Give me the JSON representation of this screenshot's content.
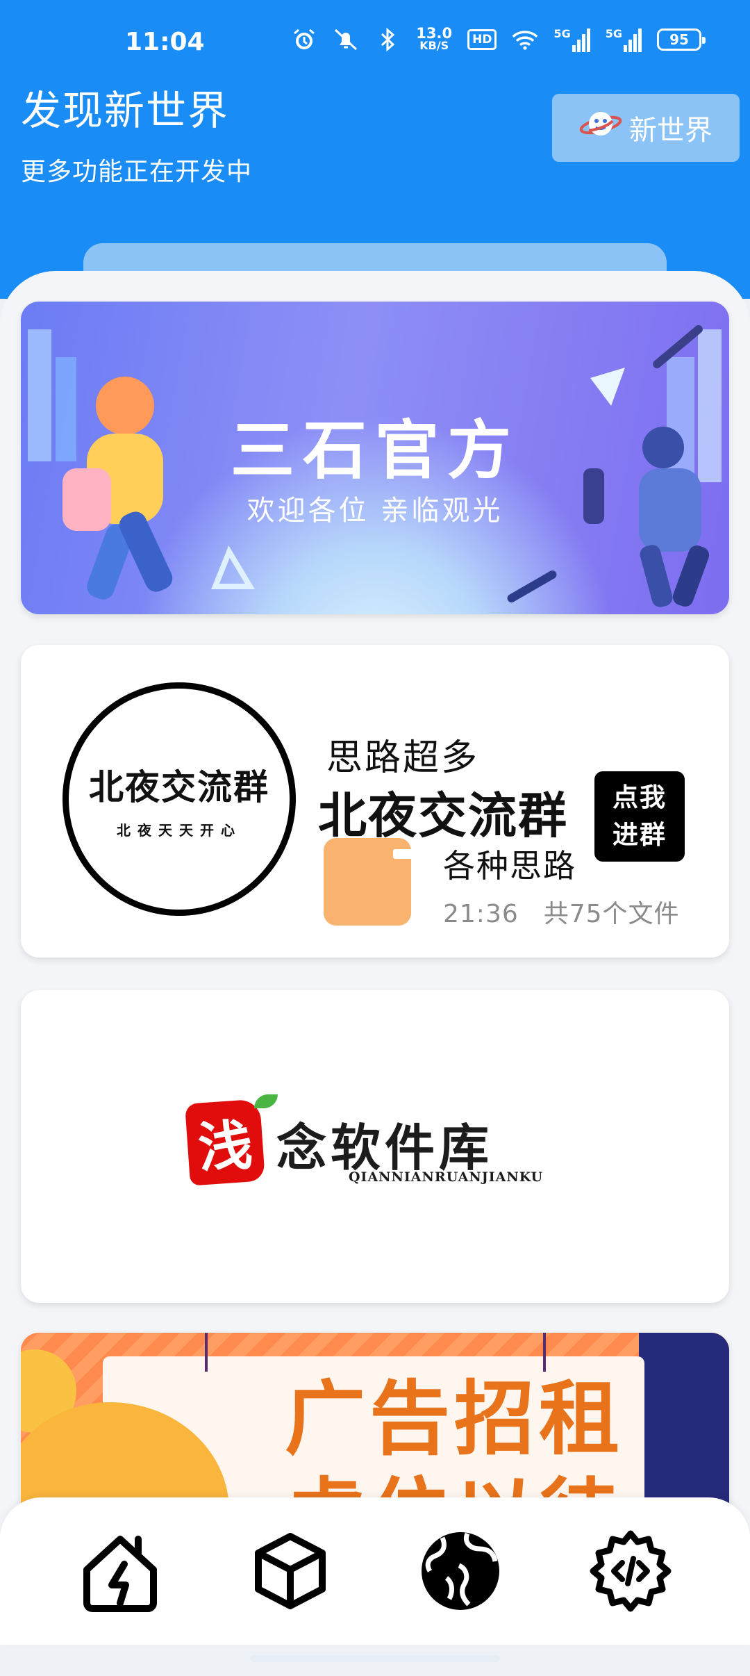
{
  "status_bar": {
    "time": "11:04",
    "net_rate_value": "13.0",
    "net_rate_unit": "KB/S",
    "hd_label": "HD",
    "sim1_label": "5G",
    "sim2_label": "5G",
    "battery": "95",
    "icons": [
      "alarm-icon",
      "mute-icon",
      "bluetooth-icon",
      "wifi-icon"
    ]
  },
  "header": {
    "title": "发现新世界",
    "subtitle": "更多功能正在开发中",
    "new_world_button": "新世界"
  },
  "cards": {
    "official_banner": {
      "title": "三石官方",
      "subtitle": "欢迎各位 亲临观光"
    },
    "group_card": {
      "logo_main": "北夜交流群",
      "logo_small": "北夜天天开心",
      "tag": "思路超多",
      "name": "北夜交流群",
      "join_line1": "点我",
      "join_line2": "进群",
      "folder_name": "各种思路",
      "folder_time": "21:36",
      "folder_count": "共75个文件"
    },
    "library_card": {
      "badge": "浅",
      "name": "念软件库",
      "pinyin": "QIANNIANRUANJIANKU"
    },
    "ad_card": {
      "text_line1": "广告招租",
      "text_line2": "虚位以待"
    }
  },
  "bottom_nav": {
    "items": [
      "home-lightning-icon",
      "cube-icon",
      "globe-icon",
      "code-gear-icon"
    ]
  },
  "colors": {
    "primary": "#1a8cf5",
    "button_bg": "#8cc3f6",
    "folder": "#f9b36f",
    "ad_orange": "#e8731a"
  }
}
